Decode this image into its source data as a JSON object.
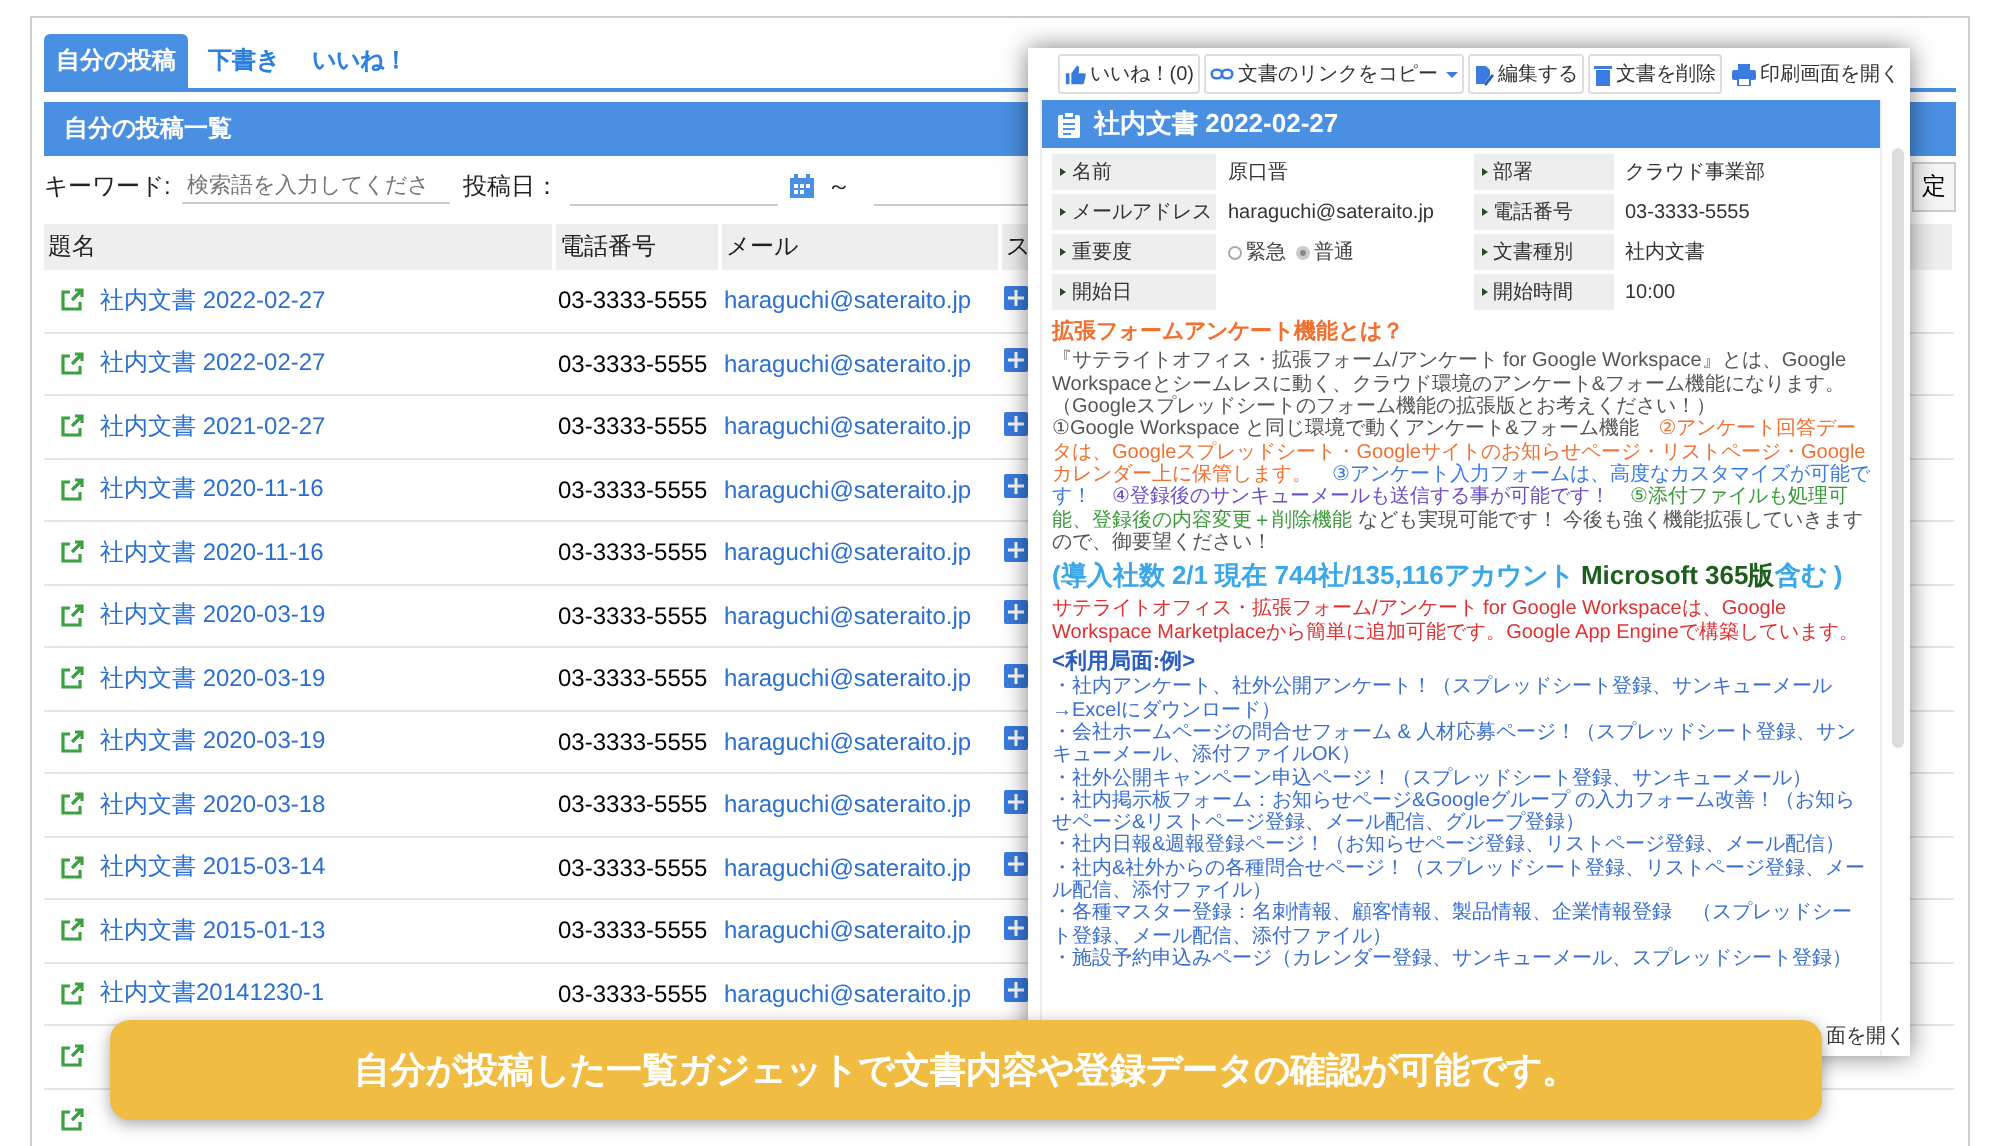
{
  "tabs": [
    {
      "label": "自分の投稿",
      "selected": true
    },
    {
      "label": "下書き",
      "selected": false
    },
    {
      "label": "いいね！",
      "selected": false
    }
  ],
  "list_header": "自分の投稿一覧",
  "filter": {
    "keyword_label": "キーワード:",
    "keyword_placeholder": "検索語を入力してくださ",
    "date_label": "投稿日：",
    "range_separator": "～",
    "button": "定"
  },
  "table": {
    "columns": [
      "題名",
      "電話番号",
      "メール",
      "ス"
    ],
    "rows": [
      {
        "title": "社内文書 2022-02-27",
        "phone": "03-3333-5555",
        "email": "haraguchi@sateraito.jp"
      },
      {
        "title": "社内文書 2022-02-27",
        "phone": "03-3333-5555",
        "email": "haraguchi@sateraito.jp"
      },
      {
        "title": "社内文書 2021-02-27",
        "phone": "03-3333-5555",
        "email": "haraguchi@sateraito.jp"
      },
      {
        "title": "社内文書 2020-11-16",
        "phone": "03-3333-5555",
        "email": "haraguchi@sateraito.jp"
      },
      {
        "title": "社内文書 2020-11-16",
        "phone": "03-3333-5555",
        "email": "haraguchi@sateraito.jp"
      },
      {
        "title": "社内文書 2020-03-19",
        "phone": "03-3333-5555",
        "email": "haraguchi@sateraito.jp"
      },
      {
        "title": "社内文書 2020-03-19",
        "phone": "03-3333-5555",
        "email": "haraguchi@sateraito.jp"
      },
      {
        "title": "社内文書 2020-03-19",
        "phone": "03-3333-5555",
        "email": "haraguchi@sateraito.jp"
      },
      {
        "title": "社内文書 2020-03-18",
        "phone": "03-3333-5555",
        "email": "haraguchi@sateraito.jp"
      },
      {
        "title": "社内文書 2015-03-14",
        "phone": "03-3333-5555",
        "email": "haraguchi@sateraito.jp"
      },
      {
        "title": "社内文書 2015-01-13",
        "phone": "03-3333-5555",
        "email": "haraguchi@sateraito.jp"
      },
      {
        "title": "社内文書20141230-1",
        "phone": "03-3333-5555",
        "email": "haraguchi@sateraito.jp"
      },
      {
        "kind": "covered"
      },
      {
        "kind": "covered"
      }
    ]
  },
  "popup": {
    "toolbar": [
      {
        "kind": "like",
        "label": "いいね！(0)"
      },
      {
        "kind": "link",
        "label": "文書のリンクをコピー"
      },
      {
        "kind": "edit",
        "label": "編集する"
      },
      {
        "kind": "delete",
        "label": "文書を削除"
      },
      {
        "kind": "print",
        "label": "印刷画面を開く"
      }
    ],
    "title": "社内文書 2022-02-27",
    "fields": [
      {
        "label": "名前",
        "value": "原口晋"
      },
      {
        "label": "部署",
        "value": "クラウド事業部"
      },
      {
        "label": "メールアドレス",
        "value": "haraguchi@sateraito.jp"
      },
      {
        "label": "電話番号",
        "value": "03-3333-5555"
      },
      {
        "label": "重要度",
        "options": [
          {
            "label": "緊急",
            "selected": false
          },
          {
            "label": "普通",
            "selected": true
          }
        ]
      },
      {
        "label": "文書種別",
        "value": "社内文書"
      },
      {
        "label": "開始日"
      },
      {
        "label": "開始時間",
        "value": "10:00"
      }
    ],
    "heading": "拡張フォームアンケート機能とは？",
    "paragraphs": [
      [
        {
          "text": "『サテライトオフィス・拡張フォーム/アンケート for Google Workspace』とは、Google Workspaceとシームレスに動く、クラウド環境のアンケート&フォーム機能になります。（Googleスプレッドシートのフォーム機能の拡張版とお考えください！）",
          "color": "#555555"
        }
      ],
      [
        {
          "text": "①Google Workspace と同じ環境で動くアンケート&フォーム機能　",
          "color": "#555555"
        },
        {
          "text": "②アンケート回答データは、Googleスプレッドシート・Googleサイトのお知らせページ・リストページ・Googleカレンダー上に保管します。　",
          "color": "#f07030"
        },
        {
          "text": "③アンケート入力フォームは、高度なカスタマイズが可能です！　",
          "color": "#3a7be0"
        },
        {
          "text": "④登録後のサンキューメールも送信する事が可能です！　",
          "color": "#6a4fc8"
        },
        {
          "text": "⑤添付ファイルも処理可能、登録後の内容変更＋削除機能",
          "color": "#3a9a3a"
        },
        {
          "text": " なども実現可能です！ 今後も強く機能拡張していきますので、御要望ください！",
          "color": "#555555"
        }
      ]
    ],
    "stats": [
      {
        "text": "(導入社数 2/1 現在 744社/135,116アカウント ",
        "color": "#3aa8e8"
      },
      {
        "text": "Microsoft 365版",
        "color": "#1c5e1c"
      },
      {
        "text": "含む )",
        "color": "#3aa8e8"
      }
    ],
    "note": "サテライトオフィス・拡張フォーム/アンケート for Google Workspaceは、Google Workspace Marketplaceから簡単に追加可能です。Google App Engineで構築しています。",
    "usage_heading": "<利用局面:例>",
    "usage_items": [
      "・社内アンケート、社外公開アンケート！（スプレッドシート登録、サンキューメール→Excelにダウンロード）",
      "・会社ホームページの問合せフォーム & 人材応募ページ！（スプレッドシート登録、サンキューメール、添付ファイルOK）",
      "・社外公開キャンペーン申込ページ！（スプレッドシート登録、サンキューメール）",
      "・社内掲示板フォーム：お知らせページ&Googleグループ の入力フォーム改善！（お知らせページ&リストページ登録、メール配信、グループ登録）",
      "・社内日報&週報登録ページ！（お知らせページ登録、リストページ登録、メール配信）",
      "・社内&社外からの各種問合せページ！（スプレッドシート登録、リストページ登録、メール配信、添付ファイル）",
      "・各種マスター登録：名刺情報、顧客情報、製品情報、企業情報登録　（スプレッドシート登録、メール配信、添付ファイル）",
      "・施設予約申込みページ（カレンダー登録、サンキューメール、スプレッドシート登録）"
    ],
    "footer_link": "面を開く"
  },
  "banner": "自分が投稿した一覧ガジェットで文書内容や登録データの確認が可能です。"
}
